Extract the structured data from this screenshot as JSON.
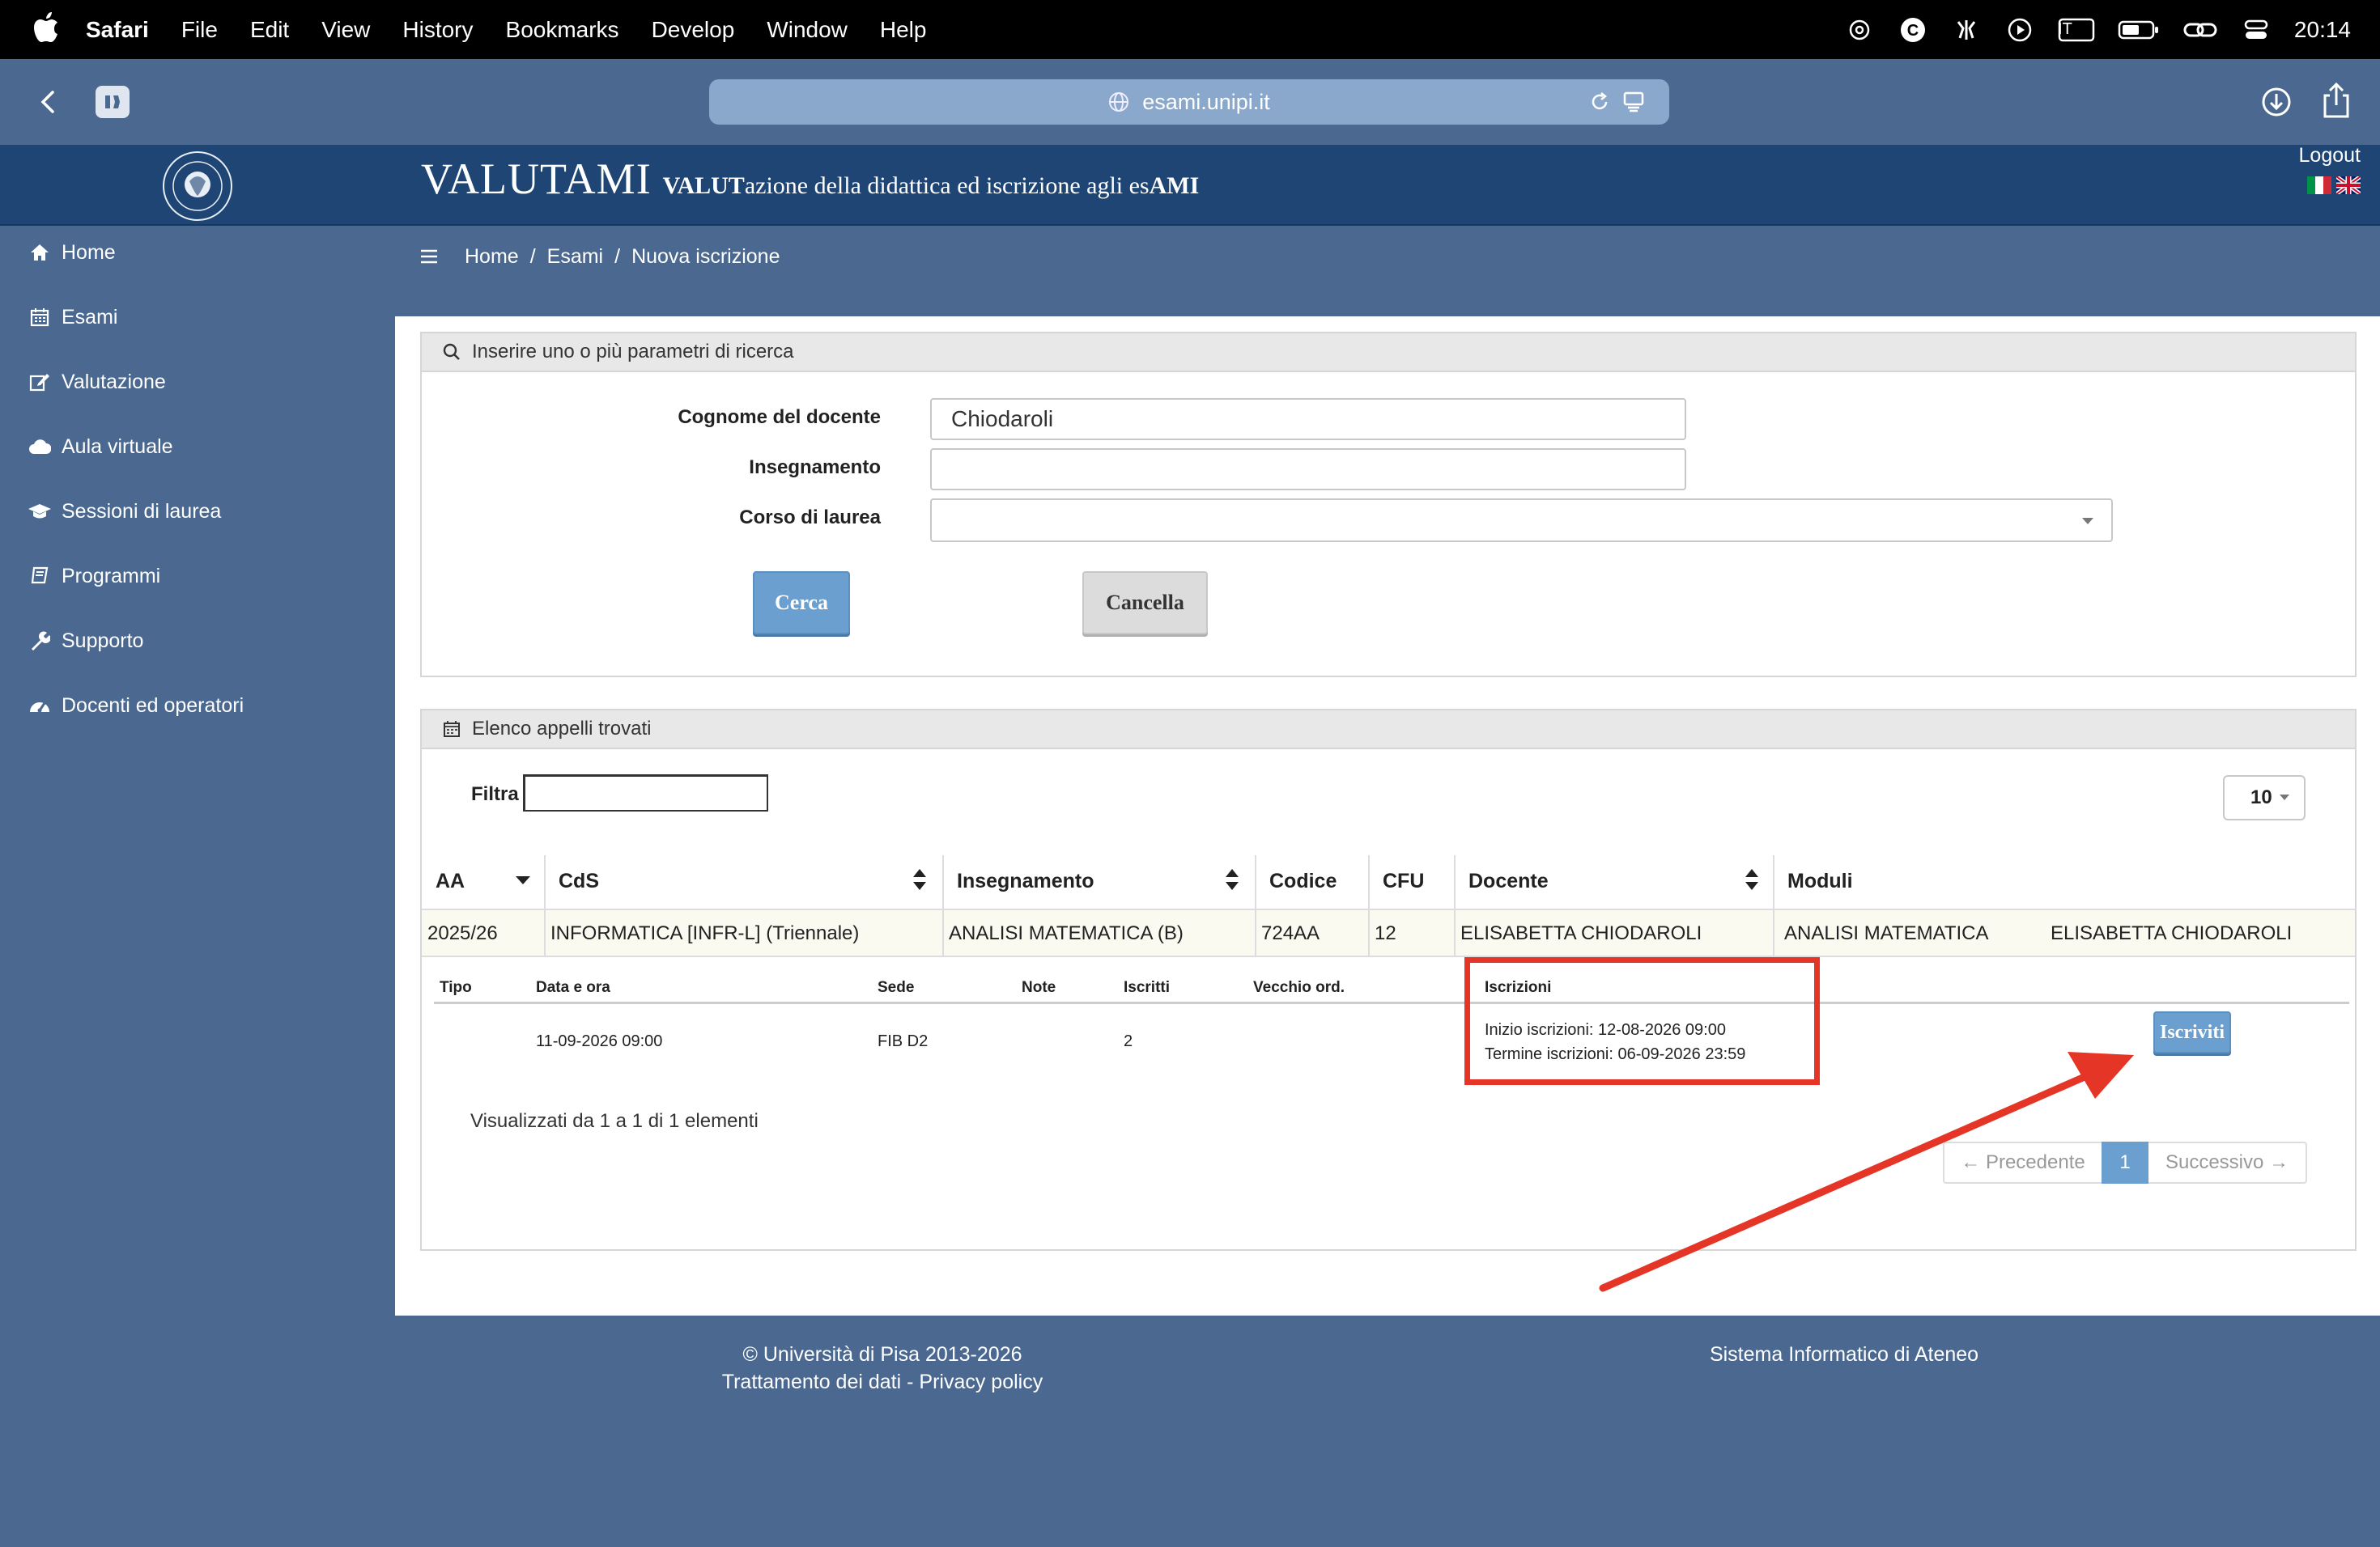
{
  "menubar": {
    "app": "Safari",
    "items": [
      "File",
      "Edit",
      "View",
      "History",
      "Bookmarks",
      "Develop",
      "Window",
      "Help"
    ],
    "input_source": "IT",
    "clock": "20:14"
  },
  "browser": {
    "url": "esami.unipi.it"
  },
  "header": {
    "title_big": "VALUTAMI",
    "title_sub_bold1": "VALUT",
    "title_sub_mid": "azione della didattica ed iscrizione agli es",
    "title_sub_bold2": "AMI",
    "logout": "Logout"
  },
  "sidebar": {
    "items": [
      {
        "label": "Home",
        "icon": "home-icon"
      },
      {
        "label": "Esami",
        "icon": "calendar-icon"
      },
      {
        "label": "Valutazione",
        "icon": "edit-icon"
      },
      {
        "label": "Aula virtuale",
        "icon": "cloud-icon"
      },
      {
        "label": "Sessioni di laurea",
        "icon": "graduation-cap-icon"
      },
      {
        "label": "Programmi",
        "icon": "book-icon"
      },
      {
        "label": "Supporto",
        "icon": "wrench-icon"
      },
      {
        "label": "Docenti ed operatori",
        "icon": "dashboard-icon"
      }
    ]
  },
  "breadcrumb": {
    "items": [
      "Home",
      "Esami",
      "Nuova iscrizione"
    ]
  },
  "search": {
    "heading": "Inserire uno o più parametri di ricerca",
    "teacher_label": "Cognome del docente",
    "teacher_value": "Chiodaroli",
    "course_label": "Insegnamento",
    "course_value": "",
    "degree_label": "Corso di laurea",
    "degree_value": "",
    "search_button": "Cerca",
    "cancel_button": "Cancella"
  },
  "results": {
    "heading": "Elenco appelli trovati",
    "filter_label": "Filtra",
    "filter_value": "",
    "page_size": "10",
    "columns": [
      "AA",
      "CdS",
      "Insegnamento",
      "Codice",
      "CFU",
      "Docente",
      "Moduli"
    ],
    "row": {
      "aa": "2025/26",
      "cds": "INFORMATICA [INFR-L] (Triennale)",
      "insegnamento": "ANALISI MATEMATICA (B)",
      "codice": "724AA",
      "cfu": "12",
      "docente": "ELISABETTA CHIODAROLI",
      "moduli_name": "ANALISI MATEMATICA",
      "moduli_docente": "ELISABETTA CHIODAROLI"
    },
    "sub_columns": [
      "Tipo",
      "Data e ora",
      "Sede",
      "Note",
      "Iscritti",
      "Vecchio ord.",
      "Iscrizioni"
    ],
    "sub_row": {
      "tipo": "",
      "data_ora": "11-09-2026 09:00",
      "sede": "FIB D2",
      "note": "",
      "iscritti": "2",
      "vecchio_ord": "",
      "inizio": "Inizio iscrizioni: 12-08-2026 09:00",
      "termine": "Termine iscrizioni: 06-09-2026 23:59"
    },
    "enroll_button": "Iscriviti",
    "info": "Visualizzati da 1 a 1 di 1 elementi",
    "pagination": {
      "prev": "← Precedente",
      "current": "1",
      "next": "Successivo →"
    }
  },
  "footer": {
    "copyright": "© Università di Pisa 2013-2026",
    "privacy": "Trattamento dei dati - Privacy policy",
    "system": "Sistema Informatico di Ateneo"
  },
  "colors": {
    "header": "#1e4573",
    "chrome": "#4a6890",
    "primary_button": "#6a9fd0",
    "annotation": "#e53527"
  }
}
